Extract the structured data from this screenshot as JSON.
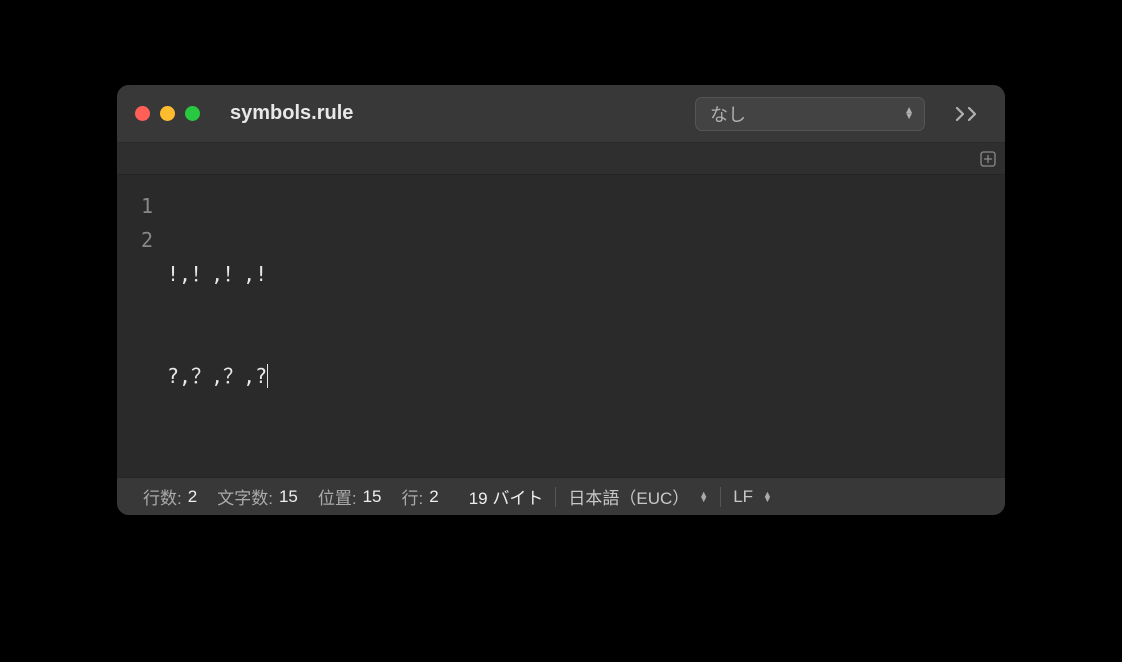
{
  "titlebar": {
    "filename": "symbols.rule",
    "syntax_mode": "なし"
  },
  "editor": {
    "lines": [
      {
        "number": "1",
        "text": "!,！,！,!"
      },
      {
        "number": "2",
        "text": "?,？,？,?"
      }
    ]
  },
  "statusbar": {
    "lines_label": "行数:",
    "lines_value": "2",
    "chars_label": "文字数:",
    "chars_value": "15",
    "position_label": "位置:",
    "position_value": "15",
    "line_label": "行:",
    "line_value": "2",
    "bytes_text": "19 バイト",
    "encoding": "日本語（EUC）",
    "line_ending": "LF"
  }
}
